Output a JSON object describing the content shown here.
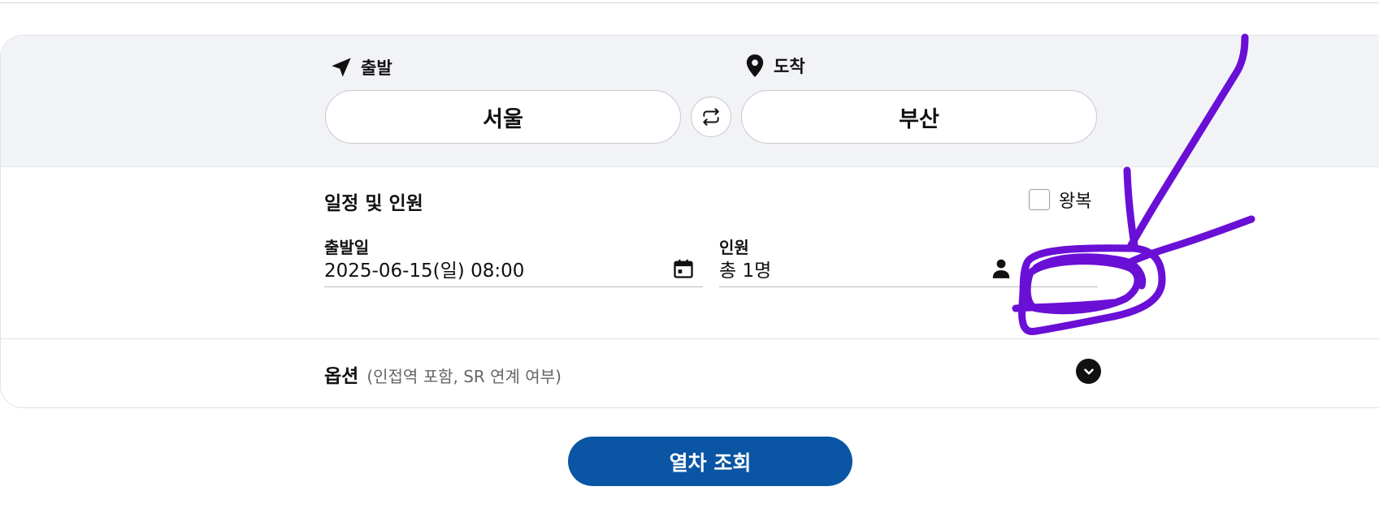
{
  "stations": {
    "departure_label": "출발",
    "arrival_label": "도착",
    "departure_value": "서울",
    "arrival_value": "부산"
  },
  "schedule": {
    "section_title": "일정 및 인원",
    "roundtrip_label": "왕복",
    "roundtrip_checked": false,
    "date_label": "출발일",
    "date_value": "2025-06-15(일) 08:00",
    "passengers_label": "인원",
    "passengers_value": "총 1명"
  },
  "options": {
    "title": "옵션",
    "hint": "(인접역 포함, SR 연계 여부)"
  },
  "search_button_label": "열차 조회",
  "icons": {
    "departure": "navigation-arrow-icon",
    "arrival": "map-pin-icon",
    "swap": "swap-arrows-icon",
    "calendar": "calendar-icon",
    "passenger": "person-icon",
    "expand": "chevron-down-circle-icon"
  },
  "colors": {
    "primary_button": "#0a55a4",
    "station_band": "#f2f3f7",
    "annotation_stroke": "#6a0fd6"
  }
}
